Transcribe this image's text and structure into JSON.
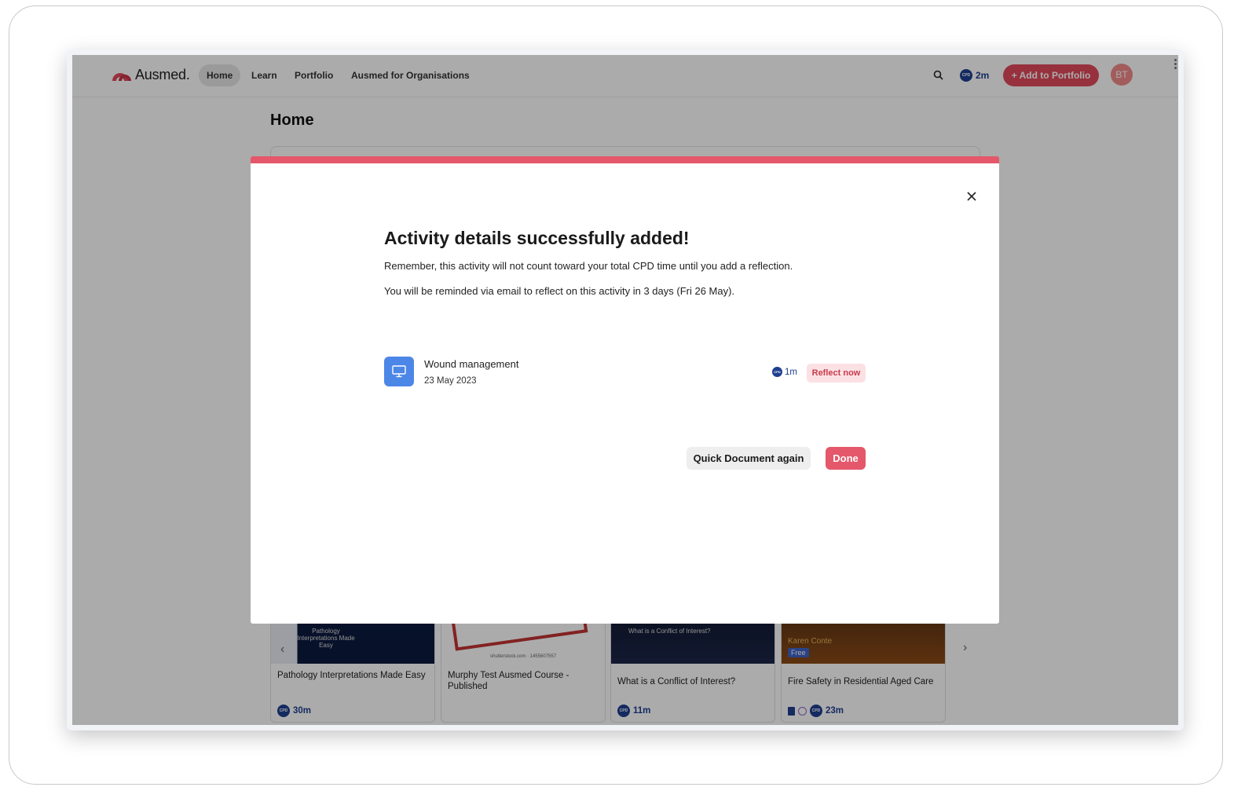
{
  "app": {
    "logo_text": "Ausmed."
  },
  "nav": {
    "items": [
      {
        "label": "Home",
        "active": true
      },
      {
        "label": "Learn"
      },
      {
        "label": "Portfolio"
      },
      {
        "label": "Ausmed for Organisations"
      }
    ],
    "cpd_time": "2m",
    "add_button": "Add to Portfolio",
    "avatar_initials": "BT"
  },
  "page": {
    "title": "Home"
  },
  "cards": [
    {
      "title": "Pathology Interpretations Made Easy",
      "thumb_text": "Pathology Interpretations Made Easy",
      "duration": "30m"
    },
    {
      "title": "Murphy Test Ausmed Course - Published",
      "thumb_text": "shutterstock.com · 1455607557",
      "duration": ""
    },
    {
      "title": "What is a Conflict of Interest?",
      "thumb_text": "What is a Conflict of Interest?",
      "duration": "11m"
    },
    {
      "title": "Fire Safety in Residential Aged Care",
      "thumb_text": "Karen Conte",
      "tag": "Free",
      "duration": "23m"
    }
  ],
  "modal": {
    "title": "Activity details successfully added!",
    "message1": "Remember, this activity will not count toward your total CPD time until you add a reflection.",
    "message2": "You will be reminded via email to reflect on this activity in 3 days (Fri 26 May).",
    "activity": {
      "name": "Wound management",
      "date": "23 May 2023",
      "cpd": "1m",
      "reflect_label": "Reflect now"
    },
    "secondary_button": "Quick Document again",
    "primary_button": "Done"
  },
  "colors": {
    "accent": "#e5576a",
    "cpd_blue": "#1f3f8f",
    "activity_icon": "#4c87e8"
  }
}
